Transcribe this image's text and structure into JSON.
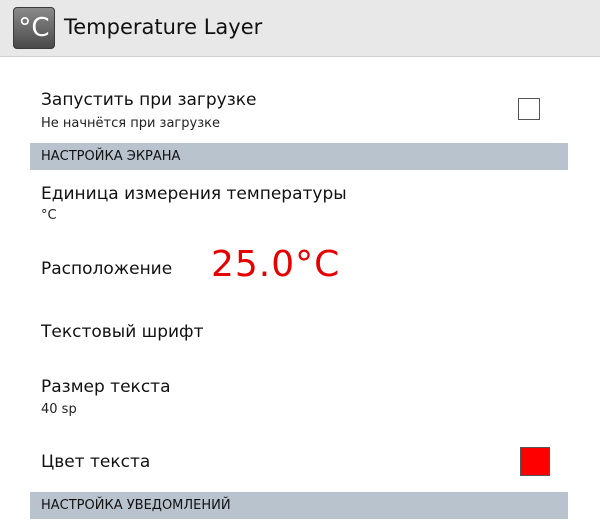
{
  "app": {
    "icon_text": "°C",
    "title": "Temperature Layer"
  },
  "settings": {
    "autostart": {
      "title": "Запустить  при загрузке",
      "summary": "Не начнётся при загрузке",
      "checked": false
    },
    "display_section": "НАСТРОЙКА ЭКРАНА",
    "unit": {
      "title": "Единица измерения температуры",
      "summary": "°C"
    },
    "position": {
      "title": "Расположение",
      "preview": "25.0°C",
      "preview_color": "#e60000"
    },
    "font": {
      "title": "Текстовый шрифт"
    },
    "text_size": {
      "title": "Размер текста",
      "summary": "40 sp"
    },
    "text_color": {
      "title": "Цвет текста",
      "color": "#ff0000"
    },
    "notification_section": "НАСТРОЙКА УВЕДОМЛЕНИЙ"
  }
}
